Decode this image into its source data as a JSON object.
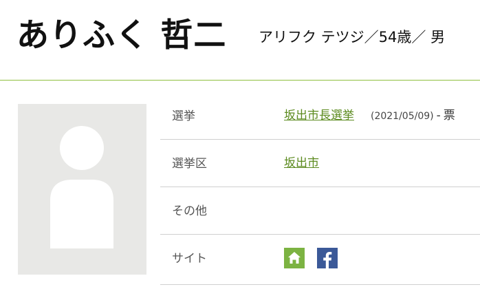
{
  "profile": {
    "name": "ありふく 哲二",
    "kana_age_sex": "アリフク テツジ／54歳／ 男"
  },
  "details": {
    "election_label": "選挙",
    "election_link": "坂出市長選挙",
    "election_date": "(2021/05/09)",
    "election_dash": "-",
    "election_votes": "票",
    "district_label": "選挙区",
    "district_link": "坂出市",
    "other_label": "その他",
    "other_value": "",
    "site_label": "サイト"
  },
  "icons": {
    "avatar": "avatar-placeholder-icon",
    "home": "home-icon",
    "facebook": "facebook-icon"
  },
  "colors": {
    "accent_green": "#7cb342",
    "link_green": "#5b8a1e",
    "facebook_blue": "#3b5998",
    "header_rule": "#8fbf3f"
  }
}
